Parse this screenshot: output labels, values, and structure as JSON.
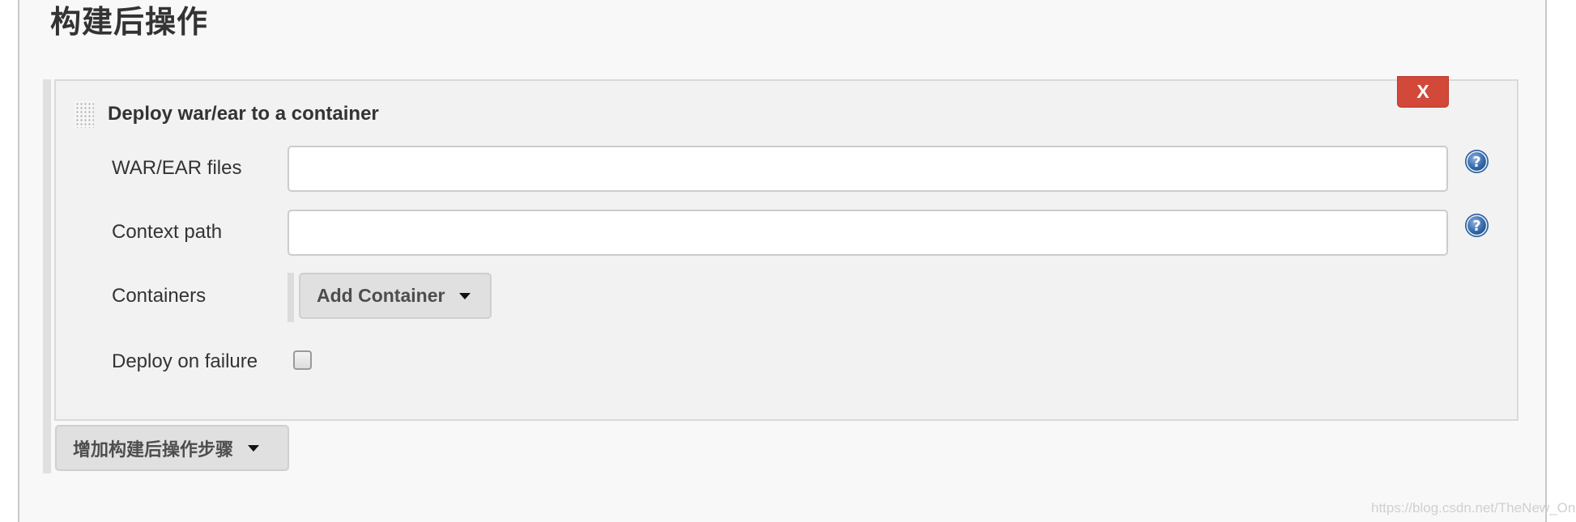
{
  "page": {
    "title": "构建后操作"
  },
  "section": {
    "title": "Deploy war/ear to a container",
    "delete_label": "X",
    "fields": [
      {
        "label": "WAR/EAR files",
        "value": "",
        "placeholder": ""
      },
      {
        "label": "Context path",
        "value": "",
        "placeholder": ""
      }
    ],
    "containers": {
      "label": "Containers",
      "button_label": "Add Container"
    },
    "deploy_on_failure": {
      "label": "Deploy on failure",
      "checked": false
    },
    "help_icon": "question-circle-icon"
  },
  "footer": {
    "add_step_label": "增加构建后操作步骤"
  },
  "watermark": "https://blog.csdn.net/TheNew_One",
  "colors": {
    "delete_button": "#d24939",
    "help_icon": "#3a6eae",
    "section_bg": "#f2f2f2",
    "page_bg": "#f8f8f8"
  }
}
